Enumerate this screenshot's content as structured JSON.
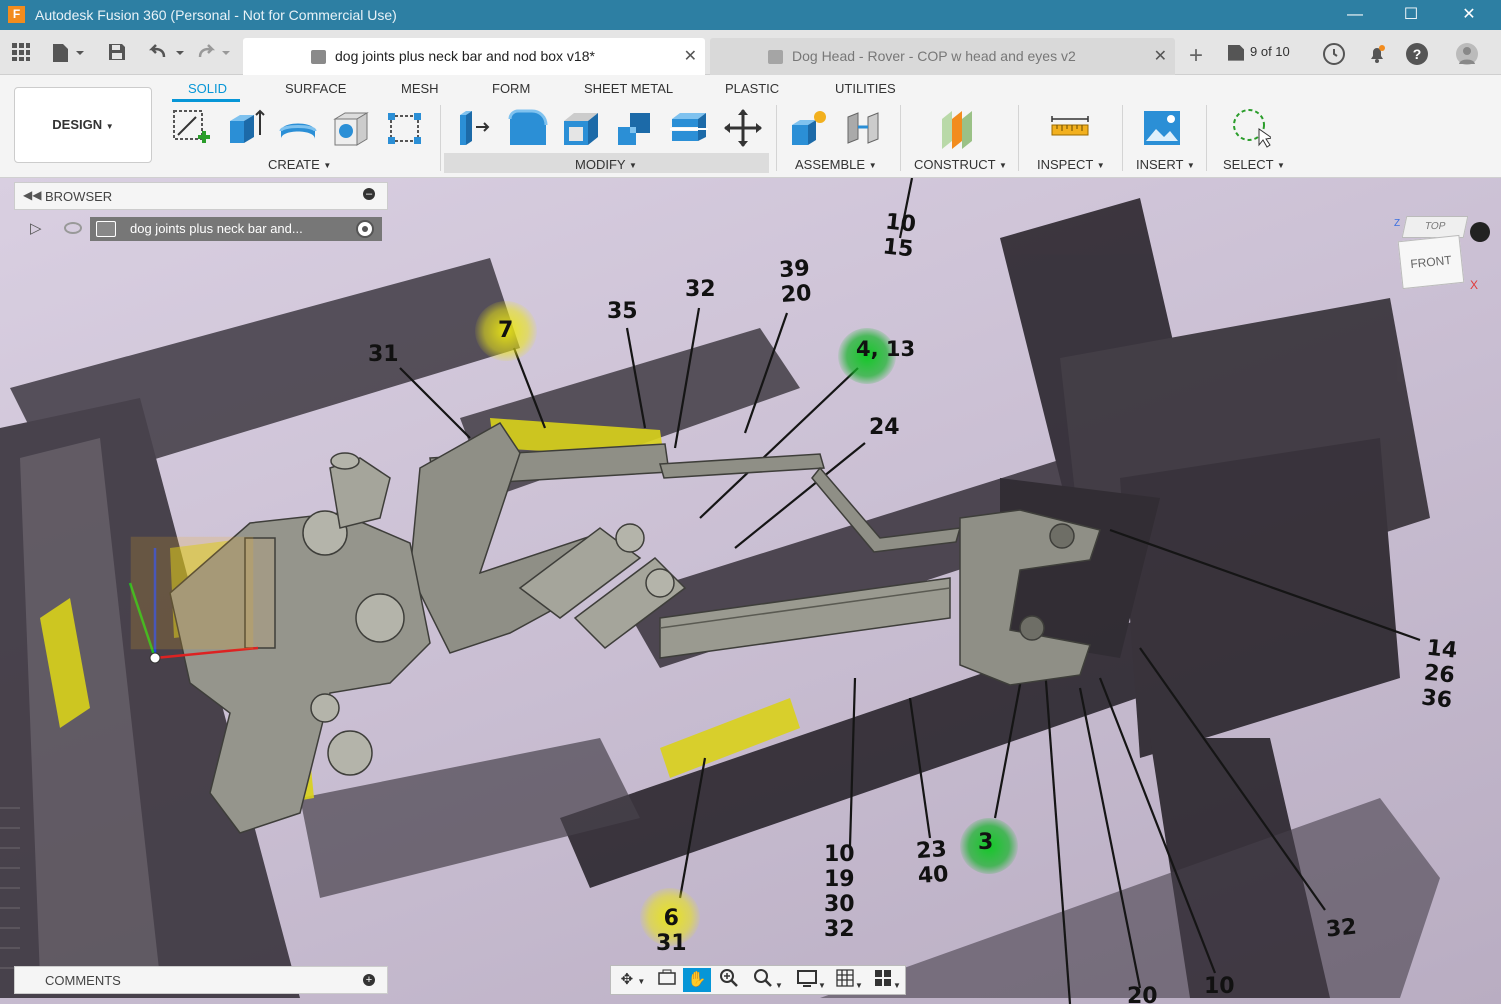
{
  "window": {
    "logo": "F",
    "title": "Autodesk Fusion 360 (Personal - Not for Commercial Use)",
    "minimize": "—",
    "maximize": "☐",
    "close": "✕"
  },
  "tabs": {
    "active": {
      "label": "dog joints plus neck bar and nod box v18*",
      "close": "✕"
    },
    "inactive": {
      "label": "Dog Head - Rover - COP w head and eyes v2",
      "close": "✕"
    },
    "new_tab": "+",
    "versions": "9 of 10"
  },
  "ribbon": {
    "workspace": "DESIGN",
    "tabs": [
      "SOLID",
      "SURFACE",
      "MESH",
      "FORM",
      "SHEET METAL",
      "PLASTIC",
      "UTILITIES"
    ],
    "groups": [
      "CREATE",
      "MODIFY",
      "ASSEMBLE",
      "CONSTRUCT",
      "INSPECT",
      "INSERT",
      "SELECT"
    ]
  },
  "browser": {
    "title": "BROWSER",
    "root_component": "dog joints plus neck bar and..."
  },
  "comments": {
    "title": "COMMENTS"
  },
  "viewcube": {
    "top": "TOP",
    "front": "FRONT",
    "z": "Z",
    "x": "X"
  },
  "callouts": [
    {
      "id": "c-10-15",
      "text": "10\n15"
    },
    {
      "id": "c-39-20",
      "text": "39\n20"
    },
    {
      "id": "c-32",
      "text": "32"
    },
    {
      "id": "c-35",
      "text": "35"
    },
    {
      "id": "c-7",
      "text": "7"
    },
    {
      "id": "c-31",
      "text": "31"
    },
    {
      "id": "c-4-13",
      "text": "4, 13"
    },
    {
      "id": "c-24",
      "text": "24"
    },
    {
      "id": "c-14-26-36",
      "text": "14\n26\n36"
    },
    {
      "id": "c-10-19-30-32",
      "text": "10\n19\n30\n32"
    },
    {
      "id": "c-23-40",
      "text": "23\n40"
    },
    {
      "id": "c-3",
      "text": "3"
    },
    {
      "id": "c-6-31",
      "text": "6\n31"
    },
    {
      "id": "c-32b",
      "text": "32"
    },
    {
      "id": "c-10b",
      "text": "10"
    },
    {
      "id": "c-20b",
      "text": "20"
    }
  ],
  "colors": {
    "titlebar": "#2d7fa3",
    "accent": "#0696d7",
    "highlight_yellow": "#ebe614",
    "highlight_green": "#14c828",
    "model_gray": "#8f8f86"
  }
}
